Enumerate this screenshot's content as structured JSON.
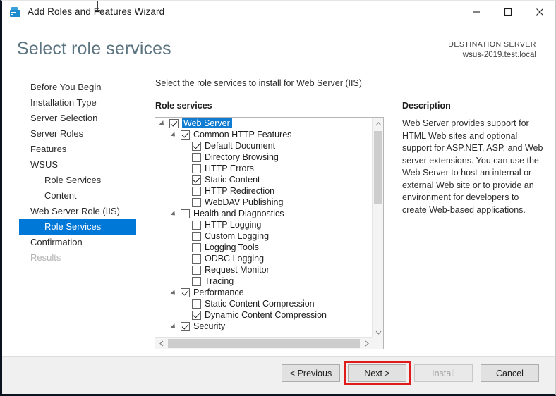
{
  "window": {
    "title": "Add Roles and Features Wizard",
    "icon": "server-wizard-icon",
    "controls": {
      "minimize": "minimize-icon",
      "maximize": "maximize-icon",
      "close": "close-icon"
    }
  },
  "header": {
    "page_title": "Select role services",
    "destination_label": "DESTINATION SERVER",
    "destination_value": "wsus-2019.test.local"
  },
  "sidebar": {
    "items": [
      {
        "label": "Before You Begin",
        "level": 0,
        "state": "normal"
      },
      {
        "label": "Installation Type",
        "level": 0,
        "state": "normal"
      },
      {
        "label": "Server Selection",
        "level": 0,
        "state": "normal"
      },
      {
        "label": "Server Roles",
        "level": 0,
        "state": "normal"
      },
      {
        "label": "Features",
        "level": 0,
        "state": "normal"
      },
      {
        "label": "WSUS",
        "level": 0,
        "state": "normal"
      },
      {
        "label": "Role Services",
        "level": 1,
        "state": "normal"
      },
      {
        "label": "Content",
        "level": 1,
        "state": "normal"
      },
      {
        "label": "Web Server Role (IIS)",
        "level": 0,
        "state": "normal"
      },
      {
        "label": "Role Services",
        "level": 1,
        "state": "selected"
      },
      {
        "label": "Confirmation",
        "level": 0,
        "state": "normal"
      },
      {
        "label": "Results",
        "level": 0,
        "state": "disabled"
      }
    ]
  },
  "main": {
    "instruction": "Select the role services to install for Web Server (IIS)",
    "section_label": "Role services",
    "tree": [
      {
        "label": "Web Server",
        "indent": 1,
        "checked": true,
        "expander": "expanded",
        "selected": true
      },
      {
        "label": "Common HTTP Features",
        "indent": 2,
        "checked": true,
        "expander": "expanded",
        "selected": false
      },
      {
        "label": "Default Document",
        "indent": 3,
        "checked": true,
        "expander": "none",
        "selected": false
      },
      {
        "label": "Directory Browsing",
        "indent": 3,
        "checked": false,
        "expander": "none",
        "selected": false
      },
      {
        "label": "HTTP Errors",
        "indent": 3,
        "checked": false,
        "expander": "none",
        "selected": false
      },
      {
        "label": "Static Content",
        "indent": 3,
        "checked": true,
        "expander": "none",
        "selected": false
      },
      {
        "label": "HTTP Redirection",
        "indent": 3,
        "checked": false,
        "expander": "none",
        "selected": false
      },
      {
        "label": "WebDAV Publishing",
        "indent": 3,
        "checked": false,
        "expander": "none",
        "selected": false
      },
      {
        "label": "Health and Diagnostics",
        "indent": 2,
        "checked": false,
        "expander": "expanded",
        "selected": false
      },
      {
        "label": "HTTP Logging",
        "indent": 3,
        "checked": false,
        "expander": "none",
        "selected": false
      },
      {
        "label": "Custom Logging",
        "indent": 3,
        "checked": false,
        "expander": "none",
        "selected": false
      },
      {
        "label": "Logging Tools",
        "indent": 3,
        "checked": false,
        "expander": "none",
        "selected": false
      },
      {
        "label": "ODBC Logging",
        "indent": 3,
        "checked": false,
        "expander": "none",
        "selected": false
      },
      {
        "label": "Request Monitor",
        "indent": 3,
        "checked": false,
        "expander": "none",
        "selected": false
      },
      {
        "label": "Tracing",
        "indent": 3,
        "checked": false,
        "expander": "none",
        "selected": false
      },
      {
        "label": "Performance",
        "indent": 2,
        "checked": true,
        "expander": "expanded",
        "selected": false
      },
      {
        "label": "Static Content Compression",
        "indent": 3,
        "checked": false,
        "expander": "none",
        "selected": false
      },
      {
        "label": "Dynamic Content Compression",
        "indent": 3,
        "checked": true,
        "expander": "none",
        "selected": false
      },
      {
        "label": "Security",
        "indent": 2,
        "checked": true,
        "expander": "expanded",
        "selected": false
      }
    ]
  },
  "description": {
    "label": "Description",
    "body": "Web Server provides support for HTML Web sites and optional support for ASP.NET, ASP, and Web server extensions. You can use the Web Server to host an internal or external Web site or to provide an environment for developers to create Web-based applications."
  },
  "footer": {
    "buttons": [
      {
        "label": "< Previous",
        "name": "previous-button",
        "disabled": false,
        "highlighted": false
      },
      {
        "label": "Next >",
        "name": "next-button",
        "disabled": false,
        "highlighted": true
      },
      {
        "label": "Install",
        "name": "install-button",
        "disabled": true,
        "highlighted": false
      },
      {
        "label": "Cancel",
        "name": "cancel-button",
        "disabled": false,
        "highlighted": false
      }
    ]
  },
  "colors": {
    "accent": "#0078d7",
    "tree_selection": "#0f7bd1",
    "title_text": "#5b7480",
    "annotation": "#e01b1b"
  }
}
